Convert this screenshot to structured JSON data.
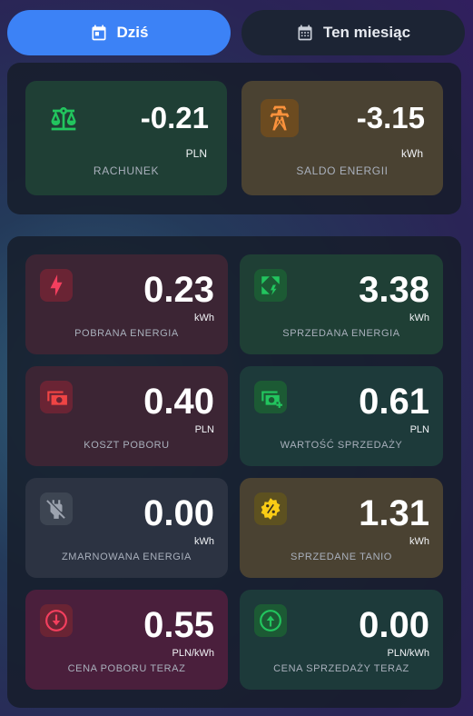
{
  "tabs": [
    {
      "label": "Dziś",
      "icon": "calendar-today-icon",
      "active": true
    },
    {
      "label": "Ten miesiąc",
      "icon": "calendar-month-icon",
      "active": false
    }
  ],
  "summary": [
    {
      "value": "-0.21",
      "unit": "PLN",
      "label": "RACHUNEK",
      "icon": "scale-balance-icon",
      "color": "#1f3f35",
      "icon_color": "#22c55e"
    },
    {
      "value": "-3.15",
      "unit": "kWh",
      "label": "SALDO ENERGII",
      "icon": "transmission-tower-icon",
      "color": "#4a4232",
      "icon_color": "#fb923c"
    }
  ],
  "metrics": [
    {
      "value": "0.23",
      "unit": "kWh",
      "label": "POBRANA ENERGIA",
      "icon": "lightning-bolt-icon",
      "icon_color": "#f43f5e"
    },
    {
      "value": "3.38",
      "unit": "kWh",
      "label": "SPRZEDANA ENERGIA",
      "icon": "solar-power-icon",
      "icon_color": "#22c55e"
    },
    {
      "value": "0.40",
      "unit": "PLN",
      "label": "KOSZT POBORU",
      "icon": "cash-minus-icon",
      "icon_color": "#ef4444"
    },
    {
      "value": "0.61",
      "unit": "PLN",
      "label": "WARTOŚĆ SPRZEDAŻY",
      "icon": "cash-plus-icon",
      "icon_color": "#22c55e"
    },
    {
      "value": "0.00",
      "unit": "kWh",
      "label": "ZMARNOWANA ENERGIA",
      "icon": "power-plug-off-icon",
      "icon_color": "#9ca3af"
    },
    {
      "value": "1.31",
      "unit": "kWh",
      "label": "SPRZEDANE TANIO",
      "icon": "percent-badge-icon",
      "icon_color": "#facc15"
    },
    {
      "value": "0.55",
      "unit": "PLN/kWh",
      "label": "CENA POBORU TERAZ",
      "icon": "arrow-down-circle-icon",
      "icon_color": "#f43f5e"
    },
    {
      "value": "0.00",
      "unit": "PLN/kWh",
      "label": "CENA SPRZEDAŻY TERAZ",
      "icon": "arrow-up-circle-icon",
      "icon_color": "#22c55e"
    }
  ]
}
